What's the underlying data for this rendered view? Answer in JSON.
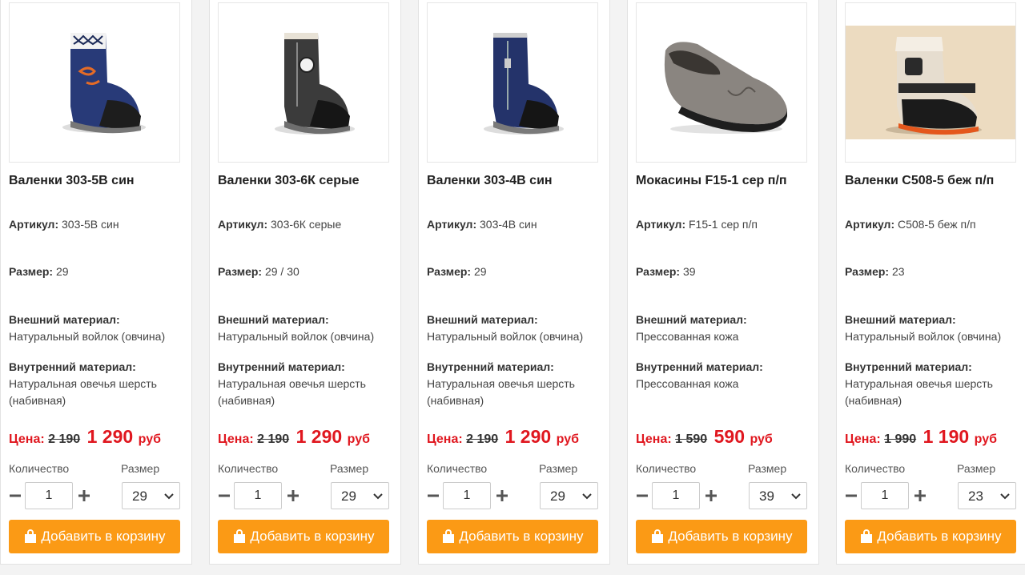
{
  "labels": {
    "article": "Артикул:",
    "size": "Размер:",
    "outer": "Внешний материал:",
    "inner": "Внутренний материал:",
    "price": "Цена:",
    "currency": "руб",
    "quantity": "Количество",
    "size_select": "Размер",
    "add_to_cart": "Добавить в корзину"
  },
  "colors": {
    "accent_button": "#fb9a15",
    "price_red": "#e0171f"
  },
  "products": [
    {
      "title": "Валенки 303-5В син",
      "article": "303-5В син",
      "size": "29",
      "outer": "Натуральный войлок (овчина)",
      "inner": "Натуральная овечья шерсть (набивная)",
      "old_price": "2 190",
      "new_price": "1 290",
      "quantity": "1",
      "selected_size": "29",
      "image": "blue-felt-boot"
    },
    {
      "title": "Валенки 303-6К серые",
      "article": "303-6К серые",
      "size": "29 / 30",
      "outer": "Натуральный войлок (овчина)",
      "inner": "Натуральная овечья шерсть (набивная)",
      "old_price": "2 190",
      "new_price": "1 290",
      "quantity": "1",
      "selected_size": "29",
      "image": "gray-felt-boot"
    },
    {
      "title": "Валенки 303-4В син",
      "article": "303-4В син",
      "size": "29",
      "outer": "Натуральный войлок (овчина)",
      "inner": "Натуральная овечья шерсть (набивная)",
      "old_price": "2 190",
      "new_price": "1 290",
      "quantity": "1",
      "selected_size": "29",
      "image": "blue-zip-boot"
    },
    {
      "title": "Мокасины F15-1 сер п/п",
      "article": "F15-1 сер п/п",
      "size": "39",
      "outer": "Прессованная кожа",
      "inner": "Прессованная кожа",
      "old_price": "1 590",
      "new_price": "590",
      "quantity": "1",
      "selected_size": "39",
      "image": "gray-moccasin"
    },
    {
      "title": "Валенки С508-5 беж п/п",
      "article": "С508-5 беж п/п",
      "size": "23",
      "outer": "Натуральный войлок (овчина)",
      "inner": "Натуральная овечья шерсть (набивная)",
      "old_price": "1 990",
      "new_price": "1 190",
      "quantity": "1",
      "selected_size": "23",
      "image": "beige-felt-boot"
    }
  ]
}
